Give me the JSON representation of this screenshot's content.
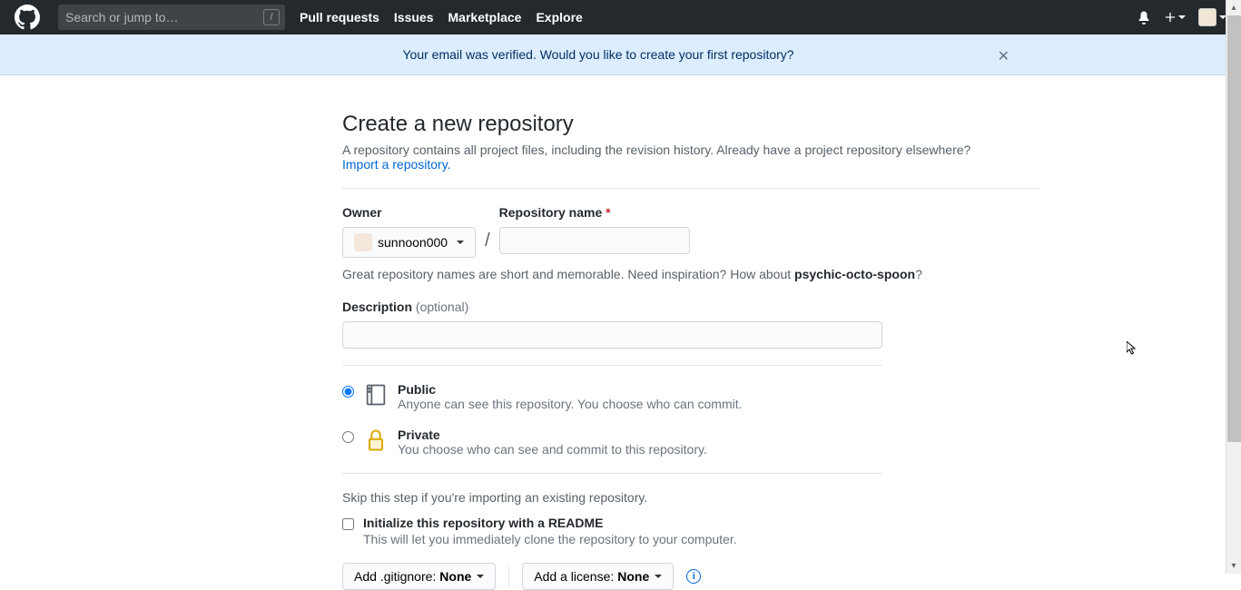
{
  "header": {
    "search_placeholder": "Search or jump to…",
    "slash_key": "/",
    "nav": [
      "Pull requests",
      "Issues",
      "Marketplace",
      "Explore"
    ]
  },
  "banner": {
    "text": "Your email was verified. Would you like to create your first repository?"
  },
  "page": {
    "title": "Create a new repository",
    "lead": "A repository contains all project files, including the revision history. Already have a project repository elsewhere?",
    "import_link": "Import a repository."
  },
  "form": {
    "owner_label": "Owner",
    "owner_value": "sunnoon000",
    "repo_label": "Repository name",
    "inspire_prefix": "Great repository names are short and memorable. Need inspiration? How about ",
    "inspire_suggestion": "psychic-octo-spoon",
    "inspire_suffix": "?",
    "desc_label": "Description",
    "optional": "(optional)",
    "public_label": "Public",
    "public_desc": "Anyone can see this repository. You choose who can commit.",
    "private_label": "Private",
    "private_desc": "You choose who can see and commit to this repository.",
    "skip_text": "Skip this step if you're importing an existing repository.",
    "readme_label": "Initialize this repository with a README",
    "readme_desc": "This will let you immediately clone the repository to your computer.",
    "gitignore_prefix": "Add .gitignore: ",
    "gitignore_value": "None",
    "license_prefix": "Add a license: ",
    "license_value": "None"
  }
}
